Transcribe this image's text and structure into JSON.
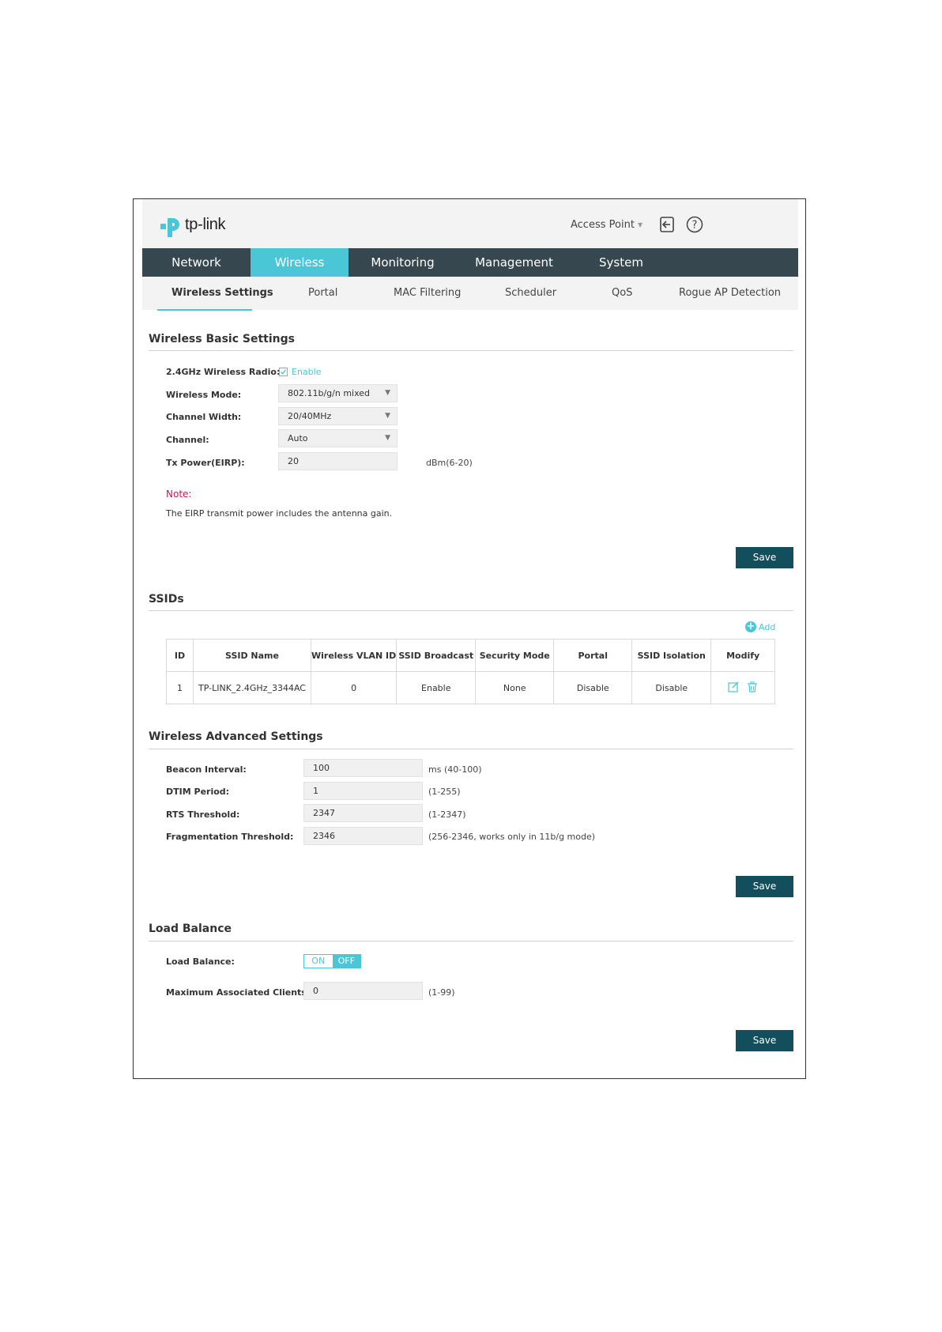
{
  "header": {
    "logo_text": "tp-link",
    "mode_label": "Access Point"
  },
  "nav": {
    "items": [
      "Network",
      "Wireless",
      "Monitoring",
      "Management",
      "System"
    ],
    "active": "Wireless"
  },
  "subnav": {
    "items": [
      "Wireless Settings",
      "Portal",
      "MAC Filtering",
      "Scheduler",
      "QoS",
      "Rogue AP Detection"
    ],
    "active": "Wireless Settings"
  },
  "basic": {
    "title": "Wireless Basic Settings",
    "radio_label": "2.4GHz Wireless Radio:",
    "radio_enable": "Enable",
    "mode_label": "Wireless Mode:",
    "mode_value": "802.11b/g/n mixed",
    "width_label": "Channel Width:",
    "width_value": "20/40MHz",
    "channel_label": "Channel:",
    "channel_value": "Auto",
    "power_label": "Tx Power(EIRP):",
    "power_value": "20",
    "power_hint": "dBm(6-20)",
    "note_title": "Note:",
    "note_text": "The EIRP transmit power includes the antenna gain.",
    "save": "Save"
  },
  "ssids": {
    "title": "SSIDs",
    "add": "Add",
    "columns": [
      "ID",
      "SSID Name",
      "Wireless VLAN ID",
      "SSID Broadcast",
      "Security Mode",
      "Portal",
      "SSID Isolation",
      "Modify"
    ],
    "rows": [
      [
        "1",
        "TP-LINK_2.4GHz_3344AC",
        "0",
        "Enable",
        "None",
        "Disable",
        "Disable"
      ]
    ]
  },
  "advanced": {
    "title": "Wireless Advanced Settings",
    "beacon_label": "Beacon Interval:",
    "beacon_value": "100",
    "beacon_hint": "ms (40-100)",
    "dtim_label": "DTIM Period:",
    "dtim_value": "1",
    "dtim_hint": "(1-255)",
    "rts_label": "RTS Threshold:",
    "rts_value": "2347",
    "rts_hint": "(1-2347)",
    "frag_label": "Fragmentation Threshold:",
    "frag_value": "2346",
    "frag_hint": "(256-2346, works only in 11b/g mode)",
    "save": "Save"
  },
  "load_balance": {
    "title": "Load Balance",
    "lb_label": "Load Balance:",
    "toggle_on": "ON",
    "toggle_off": "OFF",
    "state": "OFF",
    "max_label": "Maximum Associated Clients:",
    "max_value": "0",
    "max_hint": "(1-99)",
    "save": "Save"
  },
  "colors": {
    "accent": "#4ac6d6",
    "navbar": "#37474f",
    "save_button": "#124e5c",
    "note": "#c2185b"
  }
}
